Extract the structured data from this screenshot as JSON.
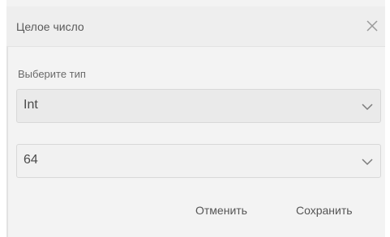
{
  "dialog": {
    "title": "Целое число",
    "close_icon": "close-icon"
  },
  "form": {
    "type_label": "Выберите тип",
    "type_value": "Int",
    "size_value": "64",
    "chevron_icon": "chevron-down-icon"
  },
  "actions": {
    "cancel_label": "Отменить",
    "save_label": "Сохранить"
  }
}
